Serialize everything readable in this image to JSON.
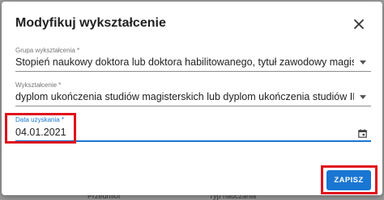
{
  "dialog": {
    "title": "Modyfikuj wykształcenie"
  },
  "fields": {
    "group": {
      "label": "Grupa wykształcenia *",
      "value": "Stopień naukowy doktora lub doktora habilitowanego, tytuł zawodowy magistra z przyg..."
    },
    "education": {
      "label": "Wykształcenie *",
      "value": "dyplom ukończenia studiów magisterskich lub dyplom ukończenia studiów II stopnia i p..."
    },
    "date": {
      "label": "Data uzyskania *",
      "value": "04.01.2021"
    }
  },
  "actions": {
    "save_label": "ZAPISZ"
  },
  "background": {
    "left_text": "Przedmiot",
    "right_text": "Typ nauczania"
  },
  "colors": {
    "accent": "#1976d2",
    "highlight": "#e0111b"
  }
}
